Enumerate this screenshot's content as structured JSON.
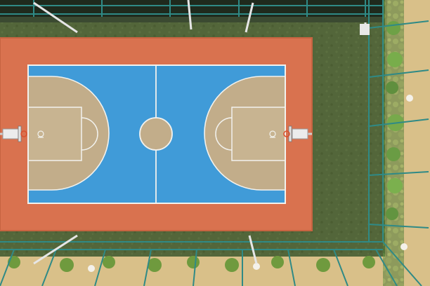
{
  "photo": {
    "subject": "basketball-court",
    "view": "aerial-top-down",
    "printed_text": []
  },
  "colors": {
    "grass": "#56683a",
    "surround": "#d9724f",
    "court_blue": "#3d98d6",
    "key_tan": "#c2ad8a",
    "lines": "#f2f2ee",
    "fence_posts": "#2f8a86",
    "walkway": "#d9c089"
  }
}
